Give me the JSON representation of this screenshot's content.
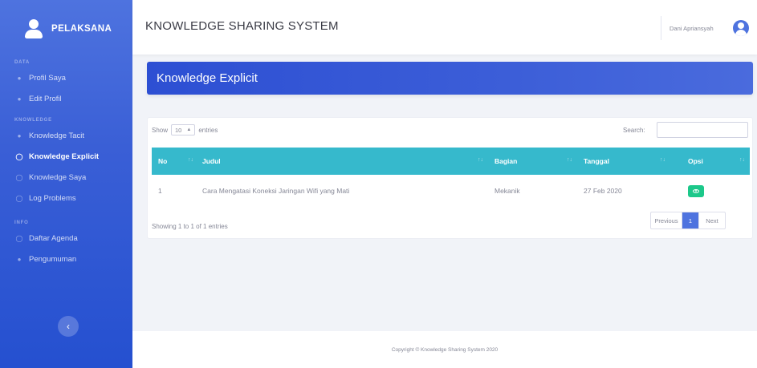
{
  "sidebar": {
    "brand": "PELAKSANA",
    "sections": {
      "profile": "DATA",
      "knowledge": "KNOWLEDGE",
      "info": "INFO"
    },
    "items": [
      {
        "label": "Profil Saya",
        "icon": "user-icon"
      },
      {
        "label": "Edit Profil",
        "icon": "user-edit-icon"
      },
      {
        "label": "Knowledge Tacit",
        "icon": "lightbulb-icon"
      },
      {
        "label": "Knowledge Explicit",
        "icon": "lightbulb-icon",
        "active": true
      },
      {
        "label": "Knowledge Saya",
        "icon": "info-circle-icon"
      },
      {
        "label": "Log Problems",
        "icon": "info-circle-icon"
      },
      {
        "label": "Daftar Agenda",
        "icon": "info-circle-icon"
      },
      {
        "label": "Pengumuman",
        "icon": "user-icon"
      }
    ],
    "toggle_icon": "chevron-left-icon"
  },
  "topbar": {
    "title": "KNOWLEDGE SHARING SYSTEM",
    "user_name": "Dani Apriansyah",
    "avatar_icon": "user-circle-icon"
  },
  "page": {
    "title": "Knowledge Explicit"
  },
  "table": {
    "length_prefix": "Show",
    "length_value": "10",
    "length_suffix": "entries",
    "search_label": "Search:",
    "search_value": "",
    "columns": [
      "No",
      "Judul",
      "Bagian",
      "Tanggal",
      "Opsi"
    ],
    "rows": [
      {
        "no": "1",
        "judul": "Cara Mengatasi Koneksi Jaringan Wifi yang Mati",
        "bagian": "Mekanik",
        "tanggal": "27 Feb 2020",
        "action_icon": "eye-icon"
      }
    ],
    "info": "Showing 1 to 1 of 1 entries",
    "pagination": {
      "previous": "Previous",
      "current": "1",
      "next": "Next"
    }
  },
  "footer": {
    "copyright": "Copyright © Knowledge Sharing System 2020"
  },
  "colors": {
    "sidebar": "#4e73df",
    "table_header": "#36b9cc",
    "action_button": "#1cc88a",
    "primary": "#4e73df"
  }
}
